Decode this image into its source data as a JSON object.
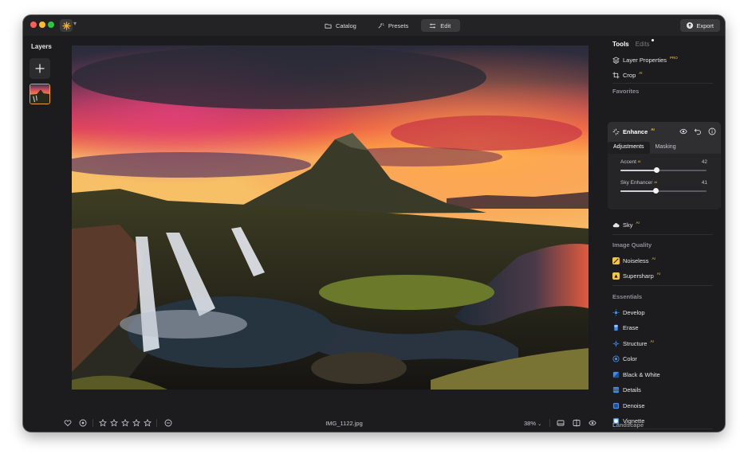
{
  "titlebar": {
    "modes": [
      {
        "label": "Catalog",
        "icon": "folder-icon",
        "active": false
      },
      {
        "label": "Presets",
        "icon": "presets-icon",
        "active": false
      },
      {
        "label": "Edit",
        "icon": "sliders-icon",
        "active": true
      }
    ],
    "export_label": "Export"
  },
  "layers": {
    "title": "Layers",
    "add_icon": "plus-icon"
  },
  "bottombar": {
    "filename": "IMG_1122.jpg",
    "zoom": "38%",
    "rating": 0,
    "rating_max": 5
  },
  "panel": {
    "tabs": {
      "tools": "Tools",
      "edits": "Edits"
    },
    "top_tools": [
      {
        "label": "Layer Properties",
        "badge": "PRO"
      },
      {
        "label": "Crop",
        "badge": "AI"
      }
    ],
    "favorites_title": "Favorites",
    "enhance": {
      "label": "Enhance",
      "badge": "AI",
      "tabs": {
        "adjustments": "Adjustments",
        "masking": "Masking"
      },
      "sliders": [
        {
          "label": "Accent",
          "badge": "AI",
          "value": "42",
          "amount": 42
        },
        {
          "label": "Sky Enhancer",
          "badge": "AI",
          "value": "41",
          "amount": 41
        }
      ]
    },
    "sky": {
      "label": "Sky",
      "badge": "AI"
    },
    "image_quality_title": "Image Quality",
    "image_quality": [
      {
        "label": "Noiseless",
        "badge": "AI"
      },
      {
        "label": "Supersharp",
        "badge": "AI"
      }
    ],
    "essentials_title": "Essentials",
    "essentials": [
      {
        "label": "Develop",
        "badge": ""
      },
      {
        "label": "Erase",
        "badge": ""
      },
      {
        "label": "Structure",
        "badge": "AI"
      },
      {
        "label": "Color",
        "badge": ""
      },
      {
        "label": "Black & White",
        "badge": ""
      },
      {
        "label": "Details",
        "badge": ""
      },
      {
        "label": "Denoise",
        "badge": ""
      },
      {
        "label": "Vignette",
        "badge": ""
      }
    ],
    "landscape_title": "Landscape"
  },
  "colors": {
    "accent_blue": "#3d8ef0",
    "badge_yellow": "#f5c542",
    "layer_border": "#f0a030"
  }
}
